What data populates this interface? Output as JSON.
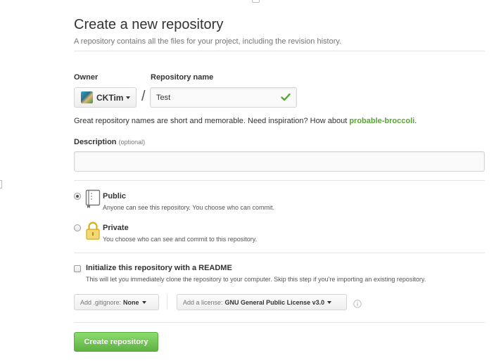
{
  "header": {
    "title": "Create a new repository",
    "subtitle": "A repository contains all the files for your project, including the revision history."
  },
  "owner": {
    "label": "Owner",
    "value": "CKTim",
    "separator": "/"
  },
  "repo_name": {
    "label": "Repository name",
    "value": "Test",
    "status_icon": "check-icon",
    "status_color": "#55a532"
  },
  "hint": {
    "text": "Great repository names are short and memorable. Need inspiration? How about ",
    "suggestion": "probable-broccoli",
    "end": "."
  },
  "description": {
    "label": "Description",
    "optional_tag": "(optional)",
    "value": "",
    "placeholder": ""
  },
  "visibility": {
    "selected": "public",
    "options": [
      {
        "title": "Public",
        "desc": "Anyone can see this repository. You choose who can commit.",
        "icon": "book-icon"
      },
      {
        "title": "Private",
        "desc": "You choose who can see and commit to this repository.",
        "icon": "lock-icon"
      }
    ]
  },
  "init": {
    "checked": false,
    "label": "Initialize this repository with a README",
    "desc": "This will let you immediately clone the repository to your computer. Skip this step if you're importing an existing repository."
  },
  "gitignore": {
    "prefix": "Add .gitignore:",
    "value": "None"
  },
  "license": {
    "prefix": "Add a license:",
    "value": "GNU General Public License v3.0",
    "info_icon": "info-icon"
  },
  "submit": {
    "label": "Create repository"
  },
  "colors": {
    "primary_button": "#6cc644",
    "suggestion_text": "#55a532",
    "border": "#d5d5d5"
  }
}
